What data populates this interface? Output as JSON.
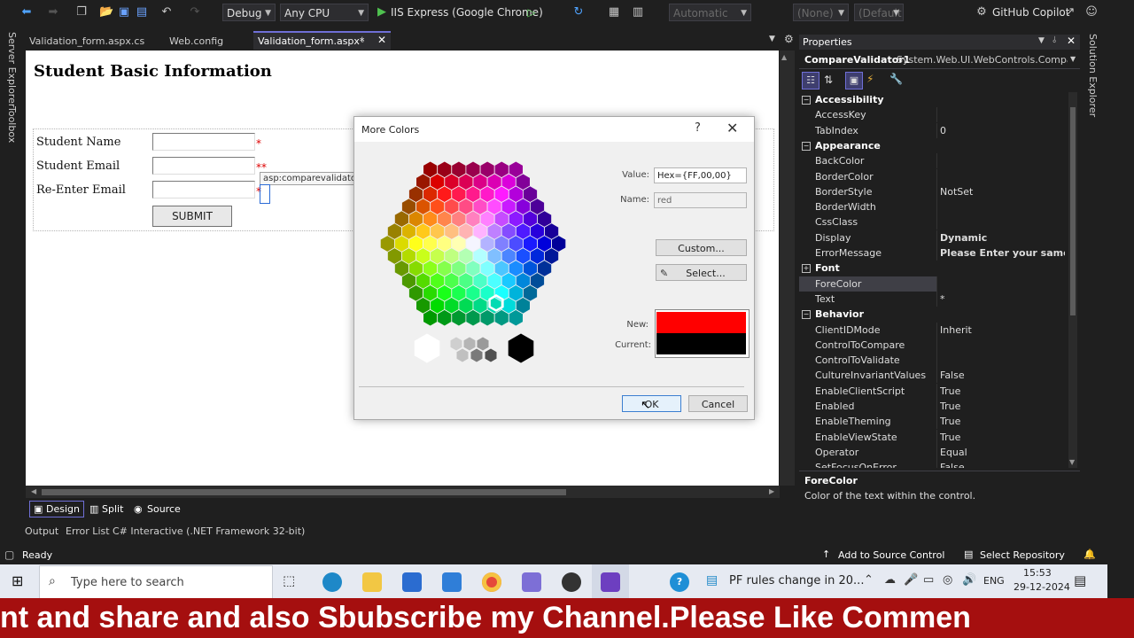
{
  "toolbar": {
    "config": "Debug",
    "platform": "Any CPU",
    "run_target": "IIS Express (Google Chrome)",
    "disabled_dd1": "Automatic",
    "disabled_dd2": "(None)",
    "disabled_dd3": "(Default",
    "copilot": "GitHub Copilot"
  },
  "side": {
    "server_explorer": "Server Explorer",
    "toolbox": "Toolbox",
    "solution_explorer": "Solution Explorer"
  },
  "tabs": [
    {
      "label": "Validation_form.aspx.cs"
    },
    {
      "label": "Web.config"
    },
    {
      "label": "Validation_form.aspx*"
    }
  ],
  "designer": {
    "title": "Student Basic Information",
    "rows": [
      {
        "label": "Student Name",
        "star": "*"
      },
      {
        "label": "Student Email",
        "star": "**"
      },
      {
        "label": "Re-Enter Email",
        "star": "*"
      }
    ],
    "submit": "SUBMIT",
    "tag_tip": "asp:comparevalidator"
  },
  "dialog": {
    "title": "More Colors",
    "help": "?",
    "value_label": "Value:",
    "value": "Hex={FF,00,00}",
    "name_label": "Name:",
    "name": "red",
    "custom": "Custom...",
    "select": "Select...",
    "new_label": "New:",
    "current_label": "Current:",
    "new_color": "#ff0000",
    "current_color": "#000000",
    "ok": "OK",
    "cancel": "Cancel"
  },
  "properties": {
    "title": "Properties",
    "object": "CompareValidator1",
    "type": "System.Web.UI.WebControls.CompareV",
    "rows": [
      {
        "cat": "Accessibility"
      },
      {
        "name": "AccessKey",
        "value": ""
      },
      {
        "name": "TabIndex",
        "value": "0"
      },
      {
        "cat": "Appearance"
      },
      {
        "name": "BackColor",
        "value": ""
      },
      {
        "name": "BorderColor",
        "value": ""
      },
      {
        "name": "BorderStyle",
        "value": "NotSet"
      },
      {
        "name": "BorderWidth",
        "value": ""
      },
      {
        "name": "CssClass",
        "value": ""
      },
      {
        "name": "Display",
        "value": "Dynamic",
        "bold": true
      },
      {
        "name": "ErrorMessage",
        "value": "Please Enter your same Ema",
        "bold": true
      },
      {
        "cat": "Font",
        "collapsed": true
      },
      {
        "name": "ForeColor",
        "value": "",
        "selected": true
      },
      {
        "name": "Text",
        "value": "*"
      },
      {
        "cat": "Behavior"
      },
      {
        "name": "ClientIDMode",
        "value": "Inherit"
      },
      {
        "name": "ControlToCompare",
        "value": ""
      },
      {
        "name": "ControlToValidate",
        "value": ""
      },
      {
        "name": "CultureInvariantValues",
        "value": "False"
      },
      {
        "name": "EnableClientScript",
        "value": "True"
      },
      {
        "name": "Enabled",
        "value": "True"
      },
      {
        "name": "EnableTheming",
        "value": "True"
      },
      {
        "name": "EnableViewState",
        "value": "True"
      },
      {
        "name": "Operator",
        "value": "Equal"
      },
      {
        "name": "SetFocusOnError",
        "value": "False"
      }
    ],
    "desc_title": "ForeColor",
    "desc_text": "Color of the text within the control."
  },
  "designbar": {
    "design": "Design",
    "split": "Split",
    "source": "Source"
  },
  "bottom_tabs": [
    "Output",
    "Error List",
    "C# Interactive (.NET Framework 32-bit)"
  ],
  "status": {
    "ready": "Ready",
    "source_control": "Add to Source Control",
    "repo": "Select Repository"
  },
  "taskbar": {
    "search": "Type here to search",
    "news": "PF rules change in 20...",
    "lang": "ENG",
    "time": "15:53",
    "date": "29-12-2024"
  },
  "banner": "nt and share and also Sbubscribe my Channel.Please Like Commen"
}
